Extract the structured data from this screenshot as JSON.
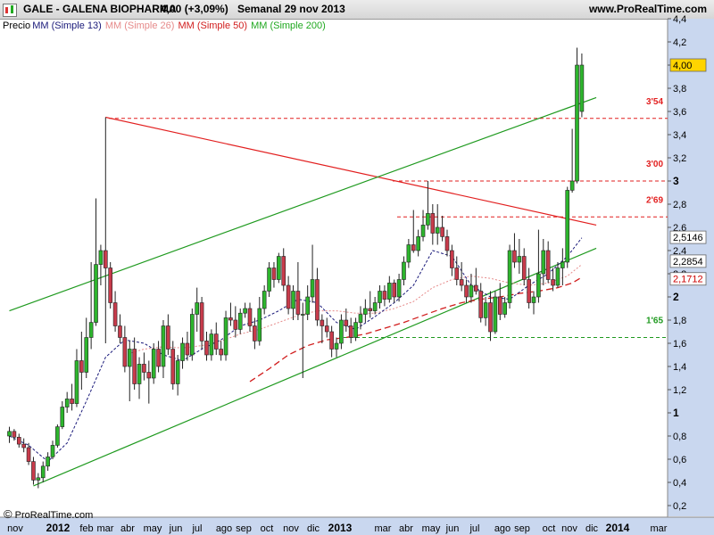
{
  "header": {
    "ticker": "GALE - GALENA BIOPHARMA",
    "price_change": "4,00 (+3,09%)",
    "period": "Semanal  29 nov 2013",
    "site": "www.ProRealTime.com"
  },
  "legend": {
    "price": "Precio",
    "mm13": "MM (Simple 13)",
    "mm26": "MM (Simple 26)",
    "mm50": "MM (Simple 50)",
    "mm200": "MM (Simple 200)"
  },
  "credit": "ProRealTime.com",
  "colors": {
    "up": "#2db52d",
    "down": "#c83b4b",
    "mm13": "#1a1a7a",
    "mm26": "#e68a8a",
    "mm50": "#d11d1d",
    "mm200": "#1fa81f",
    "trend_red": "#e21f1f",
    "trend_green": "#1f9a1f",
    "axis_bg": "#c9d7ef"
  },
  "chart_data": {
    "type": "candlestick",
    "ylim": [
      0.1,
      4.4
    ],
    "y_ticks": [
      "4,4",
      "4,2",
      "4",
      "3,8",
      "3,6",
      "3,4",
      "3,2",
      "3",
      "2,8",
      "2,6",
      "2,4",
      "2,2",
      "2",
      "1,8",
      "1,6",
      "1,4",
      "1,2",
      "1",
      "0,8",
      "0,6",
      "0,4",
      "0,2"
    ],
    "x_ticks": [
      "nov",
      "2012",
      "feb",
      "mar",
      "abr",
      "may",
      "jun",
      "jul",
      "ago",
      "sep",
      "oct",
      "nov",
      "dic",
      "2013",
      "mar",
      "abr",
      "may",
      "jun",
      "jul",
      "ago",
      "sep",
      "oct",
      "nov",
      "dic",
      "2014",
      "mar"
    ],
    "bold_ticks": [
      "2012",
      "2013",
      "2014"
    ],
    "level_labels": [
      "3'54",
      "3'00",
      "2'69",
      "1'65"
    ],
    "levels": [
      3.54,
      3.0,
      2.69,
      1.65
    ],
    "price_boxes": [
      {
        "label": "4,00",
        "value": 4.0,
        "bg": "#ffd400",
        "fg": "#000"
      },
      {
        "label": "2,5146",
        "value": 2.5146,
        "bg": "#ffffff",
        "fg": "#000"
      },
      {
        "label": "2,2854",
        "value": 2.2854,
        "bg": "#ffffff",
        "fg": "#000"
      },
      {
        "label": "2,1712",
        "value": 2.1712,
        "bg": "#ffffff",
        "fg": "#c00"
      }
    ],
    "candles_ohlc": [
      [
        0.8,
        0.88,
        0.74,
        0.84
      ],
      [
        0.84,
        0.86,
        0.76,
        0.79
      ],
      [
        0.79,
        0.82,
        0.7,
        0.73
      ],
      [
        0.73,
        0.78,
        0.66,
        0.7
      ],
      [
        0.7,
        0.74,
        0.55,
        0.58
      ],
      [
        0.58,
        0.62,
        0.38,
        0.42
      ],
      [
        0.42,
        0.48,
        0.35,
        0.44
      ],
      [
        0.44,
        0.58,
        0.4,
        0.54
      ],
      [
        0.54,
        0.66,
        0.5,
        0.62
      ],
      [
        0.62,
        0.76,
        0.6,
        0.72
      ],
      [
        0.72,
        0.9,
        0.7,
        0.88
      ],
      [
        0.88,
        1.1,
        0.86,
        1.05
      ],
      [
        1.05,
        1.18,
        1.0,
        1.12
      ],
      [
        1.12,
        1.25,
        1.02,
        1.08
      ],
      [
        1.08,
        1.55,
        1.05,
        1.45
      ],
      [
        1.45,
        1.7,
        1.2,
        1.35
      ],
      [
        1.35,
        1.82,
        1.3,
        1.65
      ],
      [
        1.65,
        2.3,
        1.55,
        1.78
      ],
      [
        1.78,
        2.85,
        1.75,
        2.28
      ],
      [
        2.28,
        2.45,
        2.1,
        2.4
      ],
      [
        2.4,
        3.55,
        1.6,
        2.25
      ],
      [
        2.25,
        2.3,
        1.9,
        1.95
      ],
      [
        1.95,
        2.05,
        1.7,
        1.75
      ],
      [
        1.75,
        1.85,
        1.6,
        1.65
      ],
      [
        1.65,
        1.75,
        1.35,
        1.4
      ],
      [
        1.4,
        1.62,
        1.1,
        1.55
      ],
      [
        1.55,
        1.65,
        1.2,
        1.25
      ],
      [
        1.25,
        1.48,
        1.12,
        1.42
      ],
      [
        1.42,
        1.52,
        1.28,
        1.35
      ],
      [
        1.35,
        1.45,
        1.08,
        1.3
      ],
      [
        1.3,
        1.6,
        1.25,
        1.55
      ],
      [
        1.55,
        1.62,
        1.35,
        1.4
      ],
      [
        1.4,
        1.8,
        1.3,
        1.75
      ],
      [
        1.75,
        1.85,
        1.5,
        1.55
      ],
      [
        1.55,
        1.62,
        1.2,
        1.25
      ],
      [
        1.25,
        1.5,
        1.15,
        1.45
      ],
      [
        1.45,
        1.65,
        1.38,
        1.6
      ],
      [
        1.6,
        1.7,
        1.45,
        1.5
      ],
      [
        1.5,
        1.9,
        1.45,
        1.85
      ],
      [
        1.85,
        2.08,
        1.7,
        1.95
      ],
      [
        1.95,
        2.0,
        1.55,
        1.62
      ],
      [
        1.62,
        1.7,
        1.45,
        1.5
      ],
      [
        1.5,
        1.72,
        1.45,
        1.68
      ],
      [
        1.68,
        1.78,
        1.5,
        1.55
      ],
      [
        1.55,
        1.62,
        1.45,
        1.5
      ],
      [
        1.5,
        1.88,
        1.45,
        1.82
      ],
      [
        1.82,
        1.95,
        1.75,
        1.8
      ],
      [
        1.8,
        1.92,
        1.65,
        1.72
      ],
      [
        1.72,
        1.9,
        1.68,
        1.86
      ],
      [
        1.86,
        1.95,
        1.82,
        1.9
      ],
      [
        1.9,
        1.95,
        1.7,
        1.75
      ],
      [
        1.75,
        1.82,
        1.55,
        1.62
      ],
      [
        1.62,
        2.0,
        1.58,
        1.9
      ],
      [
        1.9,
        2.1,
        1.85,
        2.05
      ],
      [
        2.05,
        2.3,
        2.0,
        2.25
      ],
      [
        2.25,
        2.3,
        2.08,
        2.15
      ],
      [
        2.15,
        2.38,
        2.12,
        2.35
      ],
      [
        2.35,
        2.42,
        2.05,
        2.1
      ],
      [
        2.1,
        2.18,
        1.85,
        1.9
      ],
      [
        1.9,
        2.1,
        1.8,
        2.05
      ],
      [
        2.05,
        2.3,
        1.8,
        1.85
      ],
      [
        1.85,
        1.95,
        1.3,
        1.85
      ],
      [
        1.85,
        2.1,
        1.8,
        2.0
      ],
      [
        2.0,
        2.45,
        1.95,
        2.15
      ],
      [
        2.15,
        2.25,
        1.75,
        1.8
      ],
      [
        1.8,
        1.85,
        1.6,
        1.75
      ],
      [
        1.75,
        1.82,
        1.65,
        1.7
      ],
      [
        1.7,
        1.75,
        1.48,
        1.55
      ],
      [
        1.55,
        1.65,
        1.48,
        1.6
      ],
      [
        1.6,
        1.85,
        1.55,
        1.8
      ],
      [
        1.8,
        1.9,
        1.7,
        1.75
      ],
      [
        1.75,
        1.82,
        1.6,
        1.65
      ],
      [
        1.65,
        1.82,
        1.62,
        1.78
      ],
      [
        1.78,
        1.92,
        1.72,
        1.85
      ],
      [
        1.85,
        1.98,
        1.78,
        1.9
      ],
      [
        1.9,
        2.05,
        1.82,
        1.88
      ],
      [
        1.88,
        2.0,
        1.85,
        1.95
      ],
      [
        1.95,
        2.1,
        1.9,
        2.05
      ],
      [
        2.05,
        2.1,
        1.92,
        1.98
      ],
      [
        1.98,
        2.18,
        1.95,
        2.12
      ],
      [
        2.12,
        2.15,
        1.95,
        2.0
      ],
      [
        2.0,
        2.2,
        1.96,
        2.15
      ],
      [
        2.15,
        2.35,
        2.1,
        2.3
      ],
      [
        2.3,
        2.5,
        2.25,
        2.45
      ],
      [
        2.45,
        2.75,
        2.38,
        2.4
      ],
      [
        2.4,
        2.58,
        2.35,
        2.52
      ],
      [
        2.52,
        2.75,
        2.48,
        2.62
      ],
      [
        2.62,
        3.0,
        2.58,
        2.72
      ],
      [
        2.72,
        2.8,
        2.45,
        2.55
      ],
      [
        2.55,
        2.8,
        2.45,
        2.6
      ],
      [
        2.6,
        2.7,
        2.48,
        2.52
      ],
      [
        2.52,
        2.58,
        2.35,
        2.4
      ],
      [
        2.4,
        2.45,
        2.18,
        2.25
      ],
      [
        2.25,
        2.35,
        2.1,
        2.15
      ],
      [
        2.15,
        2.3,
        2.05,
        2.1
      ],
      [
        2.1,
        2.15,
        1.95,
        2.0
      ],
      [
        2.0,
        2.2,
        1.95,
        2.1
      ],
      [
        2.1,
        2.25,
        2.02,
        2.05
      ],
      [
        2.05,
        2.12,
        1.78,
        1.82
      ],
      [
        1.82,
        2.0,
        1.75,
        1.95
      ],
      [
        1.95,
        2.05,
        1.62,
        1.7
      ],
      [
        1.7,
        2.05,
        1.68,
        2.0
      ],
      [
        2.0,
        2.12,
        1.8,
        1.85
      ],
      [
        1.85,
        2.0,
        1.82,
        1.95
      ],
      [
        1.95,
        2.45,
        1.9,
        2.4
      ],
      [
        2.4,
        2.55,
        2.25,
        2.3
      ],
      [
        2.3,
        2.5,
        2.2,
        2.35
      ],
      [
        2.35,
        2.42,
        2.1,
        2.15
      ],
      [
        2.15,
        2.25,
        1.9,
        1.95
      ],
      [
        1.95,
        2.05,
        1.85,
        2.0
      ],
      [
        2.0,
        2.58,
        1.95,
        2.2
      ],
      [
        2.2,
        2.5,
        2.1,
        2.4
      ],
      [
        2.4,
        2.48,
        2.12,
        2.15
      ],
      [
        2.15,
        2.25,
        2.05,
        2.1
      ],
      [
        2.1,
        2.3,
        2.08,
        2.25
      ],
      [
        2.25,
        2.42,
        2.1,
        2.3
      ],
      [
        2.3,
        2.95,
        2.25,
        2.92
      ],
      [
        2.92,
        3.45,
        2.9,
        3.0
      ],
      [
        3.0,
        4.15,
        2.98,
        4.0
      ],
      [
        3.6,
        4.1,
        3.55,
        4.0
      ]
    ],
    "mm13": [
      [
        0,
        0.8
      ],
      [
        4,
        0.72
      ],
      [
        8,
        0.58
      ],
      [
        12,
        0.74
      ],
      [
        16,
        1.1
      ],
      [
        20,
        1.48
      ],
      [
        24,
        1.63
      ],
      [
        28,
        1.6
      ],
      [
        32,
        1.5
      ],
      [
        36,
        1.45
      ],
      [
        40,
        1.55
      ],
      [
        44,
        1.63
      ],
      [
        48,
        1.75
      ],
      [
        52,
        1.8
      ],
      [
        56,
        1.88
      ],
      [
        60,
        1.98
      ],
      [
        64,
        1.95
      ],
      [
        68,
        1.78
      ],
      [
        72,
        1.72
      ],
      [
        76,
        1.83
      ],
      [
        80,
        1.95
      ],
      [
        84,
        2.1
      ],
      [
        88,
        2.4
      ],
      [
        92,
        2.35
      ],
      [
        96,
        2.1
      ],
      [
        100,
        2.0
      ],
      [
        104,
        1.98
      ],
      [
        108,
        2.1
      ],
      [
        112,
        2.2
      ],
      [
        116,
        2.35
      ],
      [
        119,
        2.51
      ]
    ],
    "mm26": [
      [
        24,
        1.5
      ],
      [
        28,
        1.55
      ],
      [
        32,
        1.57
      ],
      [
        36,
        1.56
      ],
      [
        40,
        1.58
      ],
      [
        44,
        1.62
      ],
      [
        48,
        1.68
      ],
      [
        52,
        1.72
      ],
      [
        56,
        1.78
      ],
      [
        60,
        1.84
      ],
      [
        64,
        1.88
      ],
      [
        68,
        1.88
      ],
      [
        72,
        1.86
      ],
      [
        76,
        1.86
      ],
      [
        80,
        1.9
      ],
      [
        84,
        1.96
      ],
      [
        88,
        2.08
      ],
      [
        92,
        2.15
      ],
      [
        96,
        2.18
      ],
      [
        100,
        2.16
      ],
      [
        104,
        2.12
      ],
      [
        108,
        2.1
      ],
      [
        112,
        2.12
      ],
      [
        116,
        2.18
      ],
      [
        119,
        2.28
      ]
    ],
    "mm50": [
      [
        50,
        1.27
      ],
      [
        54,
        1.38
      ],
      [
        58,
        1.5
      ],
      [
        62,
        1.58
      ],
      [
        66,
        1.63
      ],
      [
        70,
        1.65
      ],
      [
        74,
        1.68
      ],
      [
        78,
        1.73
      ],
      [
        82,
        1.78
      ],
      [
        86,
        1.84
      ],
      [
        90,
        1.9
      ],
      [
        94,
        1.95
      ],
      [
        98,
        1.98
      ],
      [
        102,
        2.0
      ],
      [
        106,
        2.03
      ],
      [
        110,
        2.05
      ],
      [
        114,
        2.08
      ],
      [
        117,
        2.12
      ],
      [
        119,
        2.17
      ]
    ],
    "trendlines": [
      {
        "color": "#e21f1f",
        "from": [
          20,
          3.55
        ],
        "to": [
          122,
          2.62
        ]
      },
      {
        "color": "#1f9a1f",
        "from": [
          0,
          1.88
        ],
        "to": [
          122,
          3.72
        ]
      },
      {
        "color": "#1f9a1f",
        "from": [
          5,
          0.37
        ],
        "to": [
          122,
          2.42
        ]
      }
    ]
  }
}
